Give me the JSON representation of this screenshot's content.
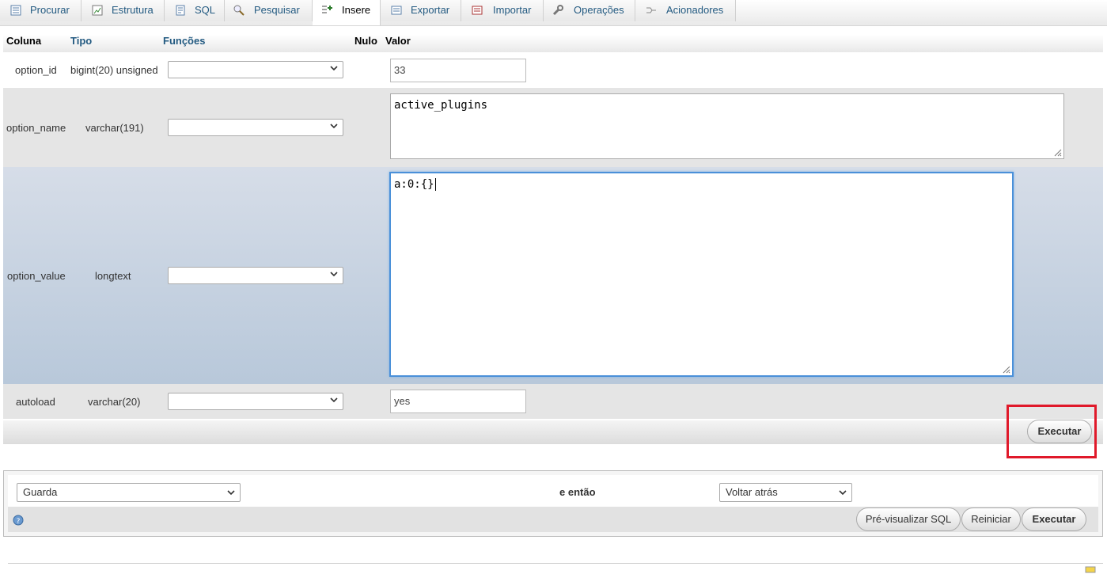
{
  "tabs": [
    {
      "label": "Procurar",
      "icon": "browse-icon"
    },
    {
      "label": "Estrutura",
      "icon": "structure-icon"
    },
    {
      "label": "SQL",
      "icon": "sql-icon"
    },
    {
      "label": "Pesquisar",
      "icon": "search-icon"
    },
    {
      "label": "Insere",
      "icon": "insert-icon",
      "active": true
    },
    {
      "label": "Exportar",
      "icon": "export-icon"
    },
    {
      "label": "Importar",
      "icon": "import-icon"
    },
    {
      "label": "Operações",
      "icon": "wrench-icon"
    },
    {
      "label": "Acionadores",
      "icon": "triggers-icon"
    }
  ],
  "table": {
    "headers": {
      "coluna": "Coluna",
      "tipo": "Tipo",
      "funcoes": "Funções",
      "nulo": "Nulo",
      "valor": "Valor"
    },
    "rows": [
      {
        "column": "option_id",
        "type": "bigint(20) unsigned",
        "function": "",
        "value": "33"
      },
      {
        "column": "option_name",
        "type": "varchar(191)",
        "function": "",
        "value": "active_plugins"
      },
      {
        "column": "option_value",
        "type": "longtext",
        "function": "",
        "value": "a:0:{}"
      },
      {
        "column": "autoload",
        "type": "varchar(20)",
        "function": "",
        "value": "yes"
      }
    ]
  },
  "execute_label": "Executar",
  "bottom": {
    "action_select": "Guarda",
    "then_label": "e então",
    "after_select": "Voltar atrás",
    "preview_label": "Pré-visualizar SQL",
    "reset_label": "Reiniciar",
    "execute_label": "Executar"
  },
  "colors": {
    "tab_text": "#235a81",
    "highlight_box": "#e0192a",
    "focus_border": "#4a90d9"
  }
}
